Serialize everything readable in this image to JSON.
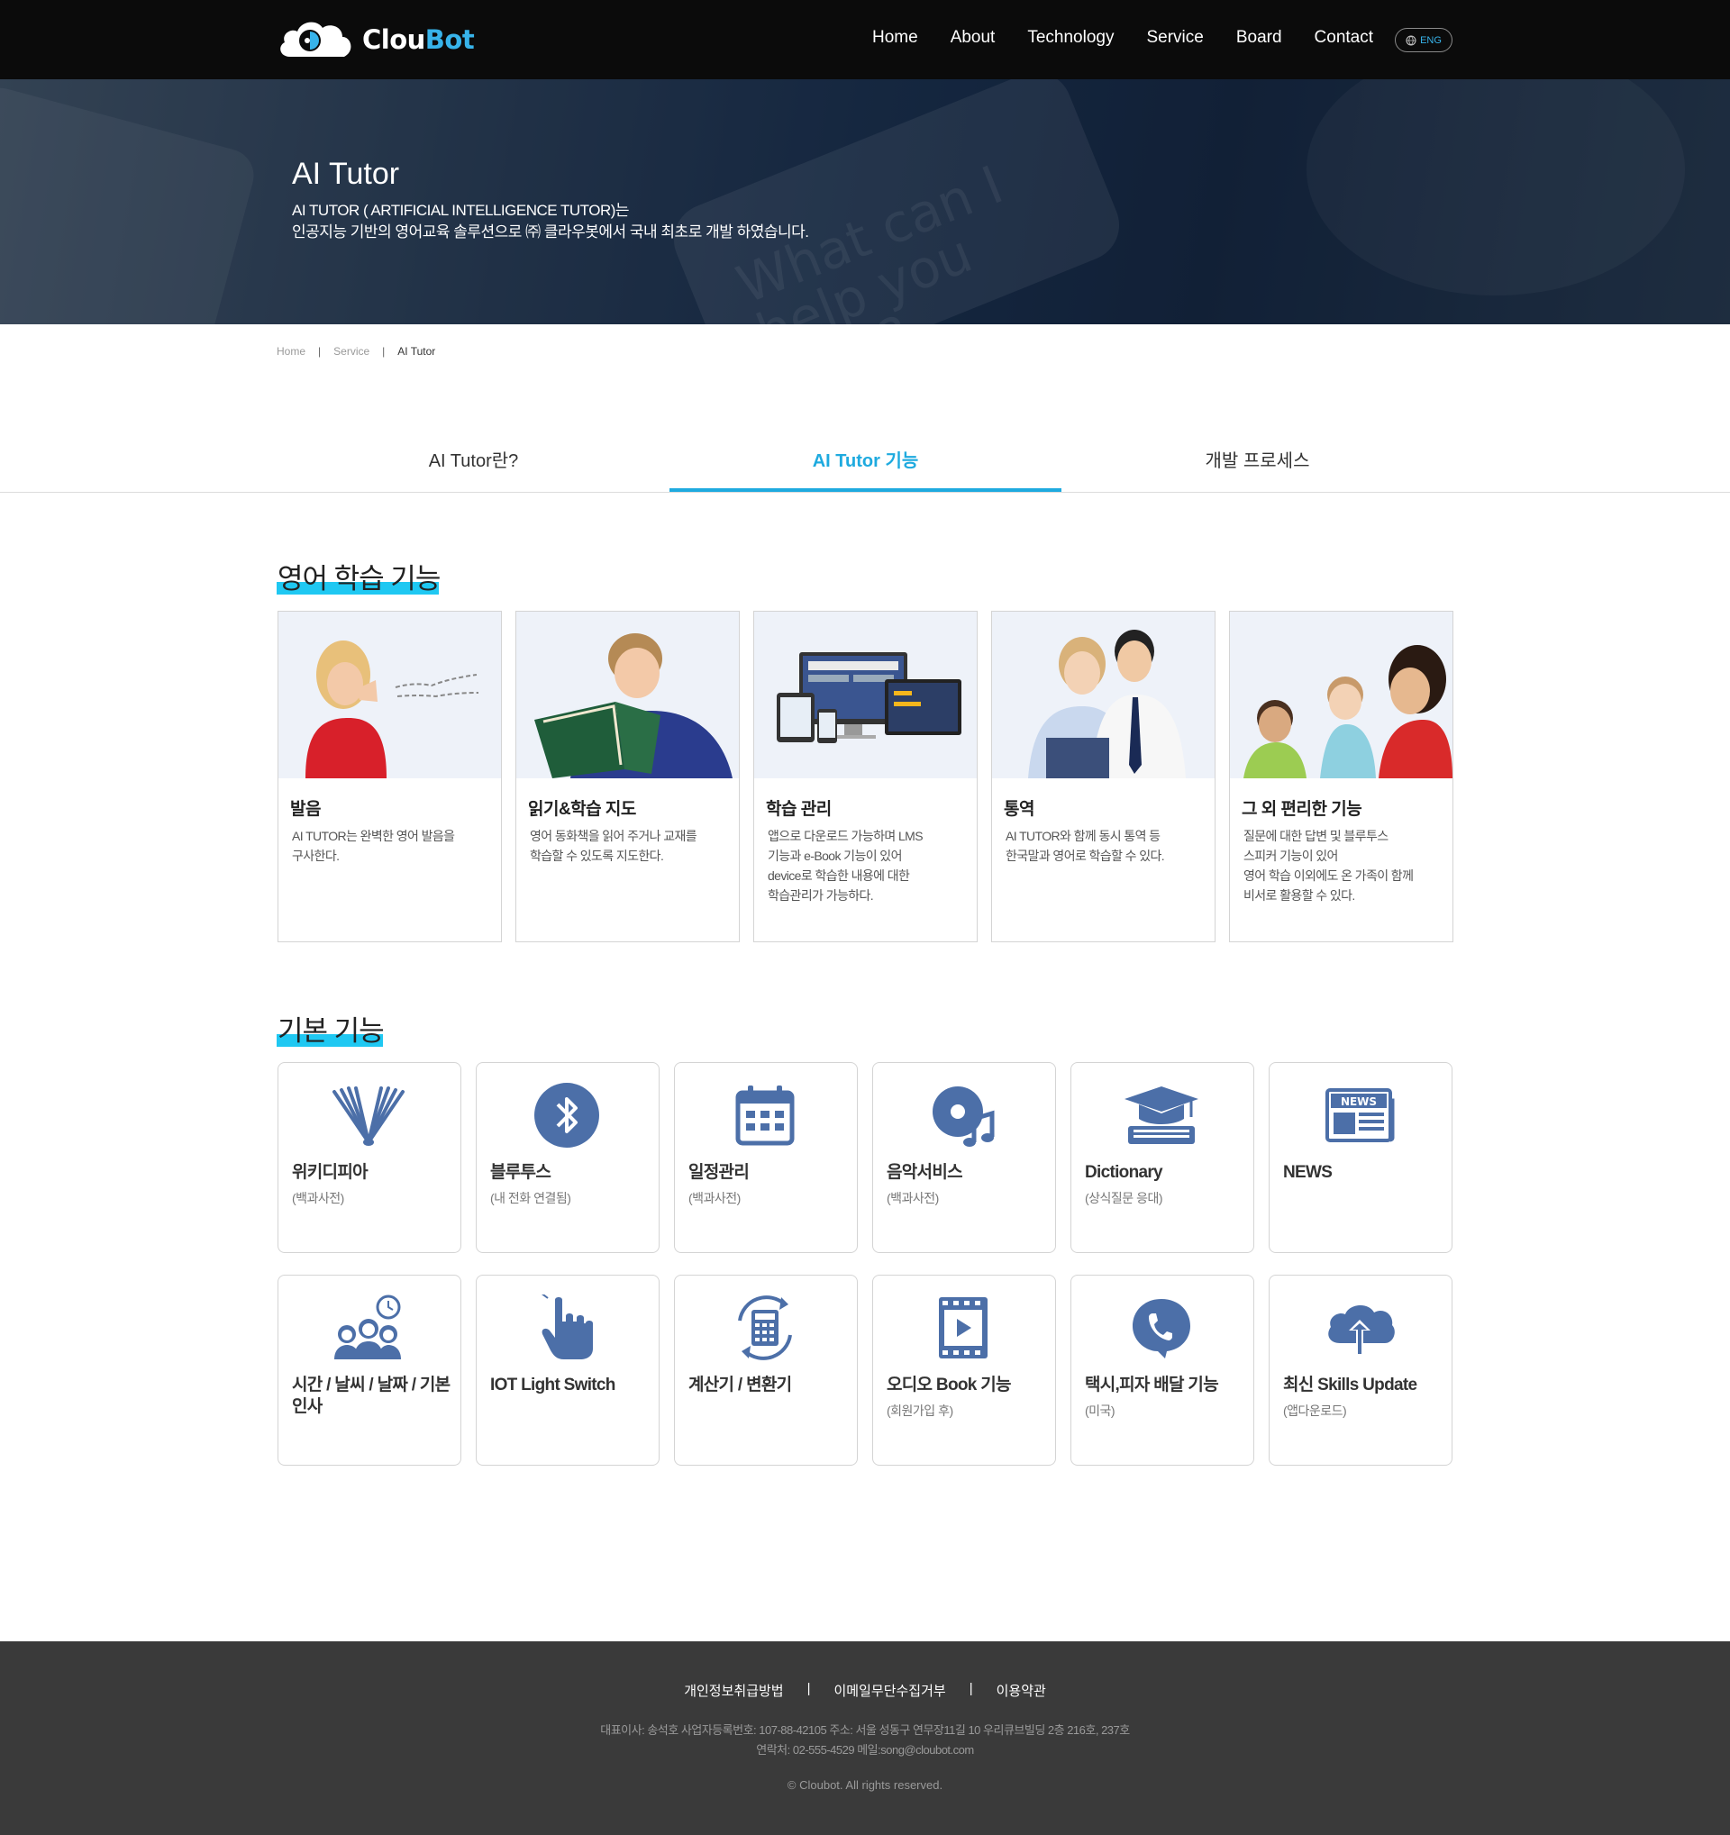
{
  "header": {
    "logo_text_1": "Clou",
    "logo_text_2": "Bot",
    "nav": [
      "Home",
      "About",
      "Technology",
      "Service",
      "Board",
      "Contact"
    ],
    "lang": "ENG"
  },
  "hero": {
    "title": "AI Tutor",
    "line1": "AI TUTOR ( ARTIFICIAL INTELLIGENCE TUTOR)는",
    "line2": "인공지능 기반의 영어교육 솔루션으로 ㈜ 클라우봇에서 국내 최초로 개발 하였습니다.",
    "bg_text": "What can I help you with?"
  },
  "breadcrumb": [
    "Home",
    "Service",
    "AI Tutor"
  ],
  "tabs": [
    "AI Tutor란?",
    "AI Tutor 기능",
    "개발 프로세스"
  ],
  "section1": {
    "heading": "영어 학습 기능",
    "cards": [
      {
        "title": "발음",
        "desc": [
          "AI TUTOR는 완벽한 영어 발음을",
          "구사한다."
        ]
      },
      {
        "title": "읽기&학습 지도",
        "desc": [
          "영어 동화책을 읽어 주거나 교재를",
          "학습할 수 있도록 지도한다."
        ]
      },
      {
        "title": "학습 관리",
        "desc": [
          "앱으로 다운로드 가능하며 LMS",
          "기능과 e-Book 기능이 있어",
          "device로 학습한 내용에 대한",
          "학습관리가 가능하다."
        ]
      },
      {
        "title": "통역",
        "desc": [
          "AI TUTOR와 함께 동시 통역 등",
          "한국말과 영어로 학습할 수 있다."
        ]
      },
      {
        "title": "그 외 편리한 기능",
        "desc": [
          "질문에 대한 답변 및 블루투스",
          "스피커 기능이 있어",
          "영어 학습 이외에도 온 가족이 함께",
          "비서로 활용할 수 있다."
        ]
      }
    ]
  },
  "section2": {
    "heading": "기본 기능",
    "cards": [
      {
        "title": "위키디피아",
        "sub": "(백과사전)",
        "icon": "book-icon"
      },
      {
        "title": "블루투스",
        "sub": "(내 전화 연결됨)",
        "icon": "bluetooth-icon"
      },
      {
        "title": "일정관리",
        "sub": "(백과사전)",
        "icon": "calendar-icon"
      },
      {
        "title": "음악서비스",
        "sub": "(백과사전)",
        "icon": "music-icon"
      },
      {
        "title": "Dictionary",
        "sub": "(상식질문 응대)",
        "icon": "graduation-cap-icon"
      },
      {
        "title": "NEWS",
        "sub": "",
        "icon": "news-icon"
      },
      {
        "title": "시간 / 날씨 / 날짜 / 기본인사",
        "sub": "",
        "icon": "people-clock-icon"
      },
      {
        "title": "IOT Light Switch",
        "sub": "",
        "icon": "hand-pointer-icon"
      },
      {
        "title": "계산기 / 변환기",
        "sub": "",
        "icon": "calculator-icon"
      },
      {
        "title": "오디오 Book 기능",
        "sub": "(회원가입 후)",
        "icon": "film-icon"
      },
      {
        "title": "택시,피자 배달 기능",
        "sub": "(미국)",
        "icon": "phone-icon"
      },
      {
        "title": "최신 Skills Update",
        "sub": "(앱다운로드)",
        "icon": "cloud-upload-icon"
      }
    ]
  },
  "footer": {
    "links": [
      "개인정보취급방법",
      "이메일무단수집거부",
      "이용약관"
    ],
    "info1": "대표이사: 송석호  사업자등록번호: 107-88-42105  주소: 서울 성동구 연무장11길 10 우리큐브빌딩 2층 216호, 237호",
    "info2": "연락처: 02-555-4529  메일:song@cloubot.com",
    "copyright": "© Cloubot. All rights reserved."
  },
  "colors": {
    "accent": "#1eaadf",
    "highlight": "#1fc8f2",
    "icon": "#4c6fa8",
    "header_bg": "#0b0b0b",
    "footer_bg": "#3a3a3a"
  }
}
